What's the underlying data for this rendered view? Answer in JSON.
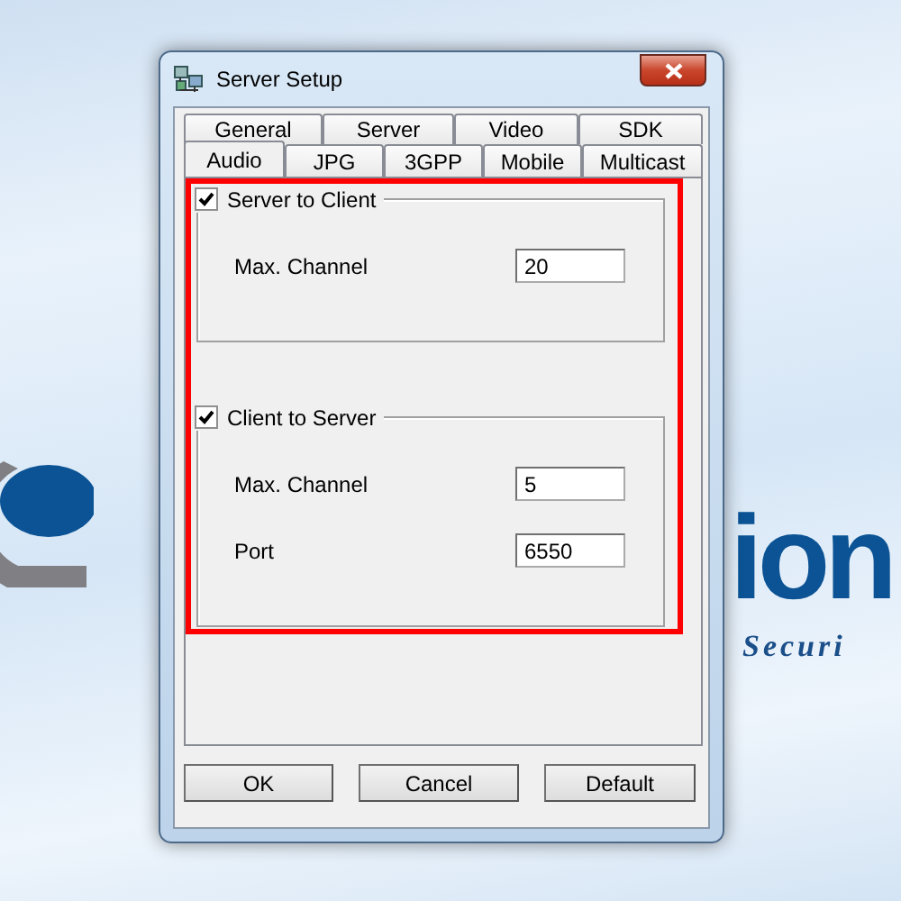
{
  "window": {
    "title": "Server Setup"
  },
  "tab_rows": [
    [
      {
        "label": "General",
        "selected": false
      },
      {
        "label": "Server",
        "selected": false
      },
      {
        "label": "Video",
        "selected": false
      },
      {
        "label": "SDK",
        "selected": false
      }
    ],
    [
      {
        "label": "Audio",
        "selected": true
      },
      {
        "label": "JPG",
        "selected": false
      },
      {
        "label": "3GPP",
        "selected": false
      },
      {
        "label": "Mobile",
        "selected": false
      },
      {
        "label": "Multicast",
        "selected": false
      }
    ]
  ],
  "groups": [
    {
      "label": "Server to Client",
      "checked": true,
      "fields": [
        {
          "label": "Max. Channel",
          "value": "20"
        }
      ]
    },
    {
      "label": "Client to Server",
      "checked": true,
      "fields": [
        {
          "label": "Max. Channel",
          "value": "5"
        },
        {
          "label": "Port",
          "value": "6550"
        }
      ]
    }
  ],
  "buttons": [
    "OK",
    "Cancel",
    "Default"
  ],
  "background": {
    "logo_text": "ion",
    "tagline": "Securi"
  }
}
